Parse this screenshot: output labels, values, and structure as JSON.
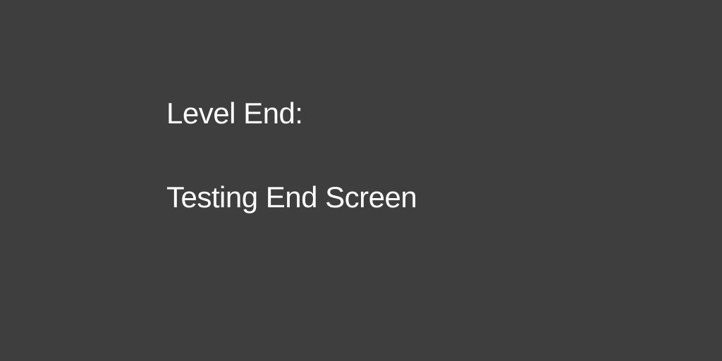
{
  "screen": {
    "heading": "Level End:",
    "message": "Testing End Screen"
  },
  "colors": {
    "background": "#3e3e3e",
    "text": "#ffffff"
  }
}
